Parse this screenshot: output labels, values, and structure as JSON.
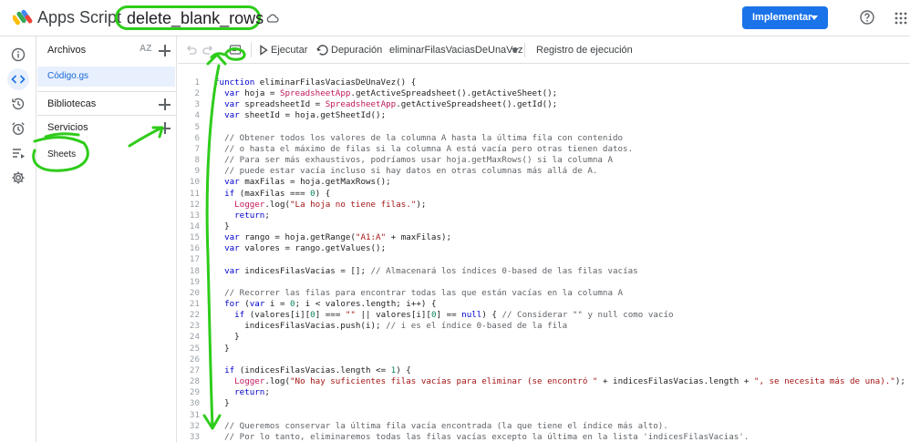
{
  "app": {
    "name": "Apps Script",
    "project_title": "delete_blank_rows",
    "deploy_label": "Implementar"
  },
  "colors": {
    "accent": "#1a73e8",
    "annotation": "#2ecc1a"
  },
  "rail": {
    "items": [
      {
        "name": "info-icon",
        "active": false
      },
      {
        "name": "code-icon",
        "active": true
      },
      {
        "name": "history-icon",
        "active": false
      },
      {
        "name": "alarm-icon",
        "active": false
      },
      {
        "name": "executions-icon",
        "active": false
      },
      {
        "name": "gear-icon",
        "active": false
      }
    ]
  },
  "files": {
    "title": "Archivos",
    "sort_label": "AZ",
    "items": [
      {
        "label": "Código.gs"
      }
    ],
    "sections": [
      {
        "label": "Bibliotecas"
      },
      {
        "label": "Servicios"
      }
    ],
    "services": [
      {
        "label": "Sheets"
      }
    ]
  },
  "toolbar": {
    "run_label": "Ejecutar",
    "debug_label": "Depuración",
    "function_select": "eliminarFilasVaciasDeUnaVez",
    "log_label": "Registro de ejecución"
  },
  "code": {
    "lines": [
      {
        "n": "1",
        "t": "function eliminarFilasVaciasDeUnaVez() {"
      },
      {
        "n": "2",
        "t": "  var hoja = SpreadsheetApp.getActiveSpreadsheet().getActiveSheet();"
      },
      {
        "n": "3",
        "t": "  var spreadsheetId = SpreadsheetApp.getActiveSpreadsheet().getId();"
      },
      {
        "n": "4",
        "t": "  var sheetId = hoja.getSheetId();"
      },
      {
        "n": "5",
        "t": ""
      },
      {
        "n": "6",
        "t": "  // Obtener todos los valores de la columna A hasta la última fila con contenido"
      },
      {
        "n": "7",
        "t": "  // o hasta el máximo de filas si la columna A está vacía pero otras tienen datos."
      },
      {
        "n": "8",
        "t": "  // Para ser más exhaustivos, podríamos usar hoja.getMaxRows() si la columna A"
      },
      {
        "n": "9",
        "t": "  // puede estar vacía incluso si hay datos en otras columnas más allá de A."
      },
      {
        "n": "10",
        "t": "  var maxFilas = hoja.getMaxRows();"
      },
      {
        "n": "11",
        "t": "  if (maxFilas === 0) {"
      },
      {
        "n": "12",
        "t": "    Logger.log(\"La hoja no tiene filas.\");"
      },
      {
        "n": "13",
        "t": "    return;"
      },
      {
        "n": "14",
        "t": "  }"
      },
      {
        "n": "15",
        "t": "  var rango = hoja.getRange(\"A1:A\" + maxFilas);"
      },
      {
        "n": "16",
        "t": "  var valores = rango.getValues();"
      },
      {
        "n": "17",
        "t": ""
      },
      {
        "n": "18",
        "t": "  var indicesFilasVacias = []; // Almacenará los índices 0-based de las filas vacías"
      },
      {
        "n": "19",
        "t": ""
      },
      {
        "n": "20",
        "t": "  // Recorrer las filas para encontrar todas las que están vacías en la columna A"
      },
      {
        "n": "21",
        "t": "  for (var i = 0; i < valores.length; i++) {"
      },
      {
        "n": "22",
        "t": "    if (valores[i][0] === \"\" || valores[i][0] == null) { // Considerar \"\" y null como vacío"
      },
      {
        "n": "23",
        "t": "      indicesFilasVacias.push(i); // i es el índice 0-based de la fila"
      },
      {
        "n": "24",
        "t": "    }"
      },
      {
        "n": "25",
        "t": "  }"
      },
      {
        "n": "26",
        "t": ""
      },
      {
        "n": "27",
        "t": "  if (indicesFilasVacias.length <= 1) {"
      },
      {
        "n": "28",
        "t": "    Logger.log(\"No hay suficientes filas vacías para eliminar (se encontró \" + indicesFilasVacias.length + \", se necesita más de una).\");"
      },
      {
        "n": "29",
        "t": "    return;"
      },
      {
        "n": "30",
        "t": "  }"
      },
      {
        "n": "31",
        "t": ""
      },
      {
        "n": "32",
        "t": "  // Queremos conservar la última fila vacía encontrada (la que tiene el índice más alto)."
      },
      {
        "n": "33",
        "t": "  // Por lo tanto, eliminaremos todas las filas vacías excepto la última en la lista 'indicesFilasVacias'."
      }
    ]
  }
}
